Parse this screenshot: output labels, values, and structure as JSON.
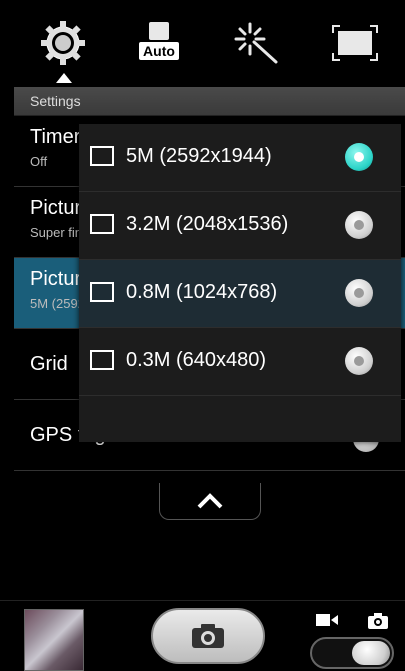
{
  "top_bar": {
    "icons": [
      "settings-gear-icon",
      "auto-mode-icon",
      "effects-wand-icon",
      "fullscreen-icon"
    ],
    "auto_label": "Auto"
  },
  "settings": {
    "header": "Settings",
    "rows": [
      {
        "label": "Timer",
        "value": "Off"
      },
      {
        "label": "Picture quality",
        "value": "Super fine"
      },
      {
        "label": "Picture size",
        "value": "5M (2592x1944)"
      },
      {
        "label": "Grid"
      },
      {
        "label": "GPS tag"
      }
    ]
  },
  "popup": {
    "options": [
      {
        "label": "5M (2592x1944)",
        "selected": true
      },
      {
        "label": "3.2M (2048x1536)",
        "selected": false
      },
      {
        "label": "0.8M (1024x768)",
        "selected": false
      },
      {
        "label": "0.3M (640x480)",
        "selected": false
      }
    ]
  },
  "colors": {
    "accent": "#2bd3c7",
    "selected_row": "#1a5e7a"
  }
}
